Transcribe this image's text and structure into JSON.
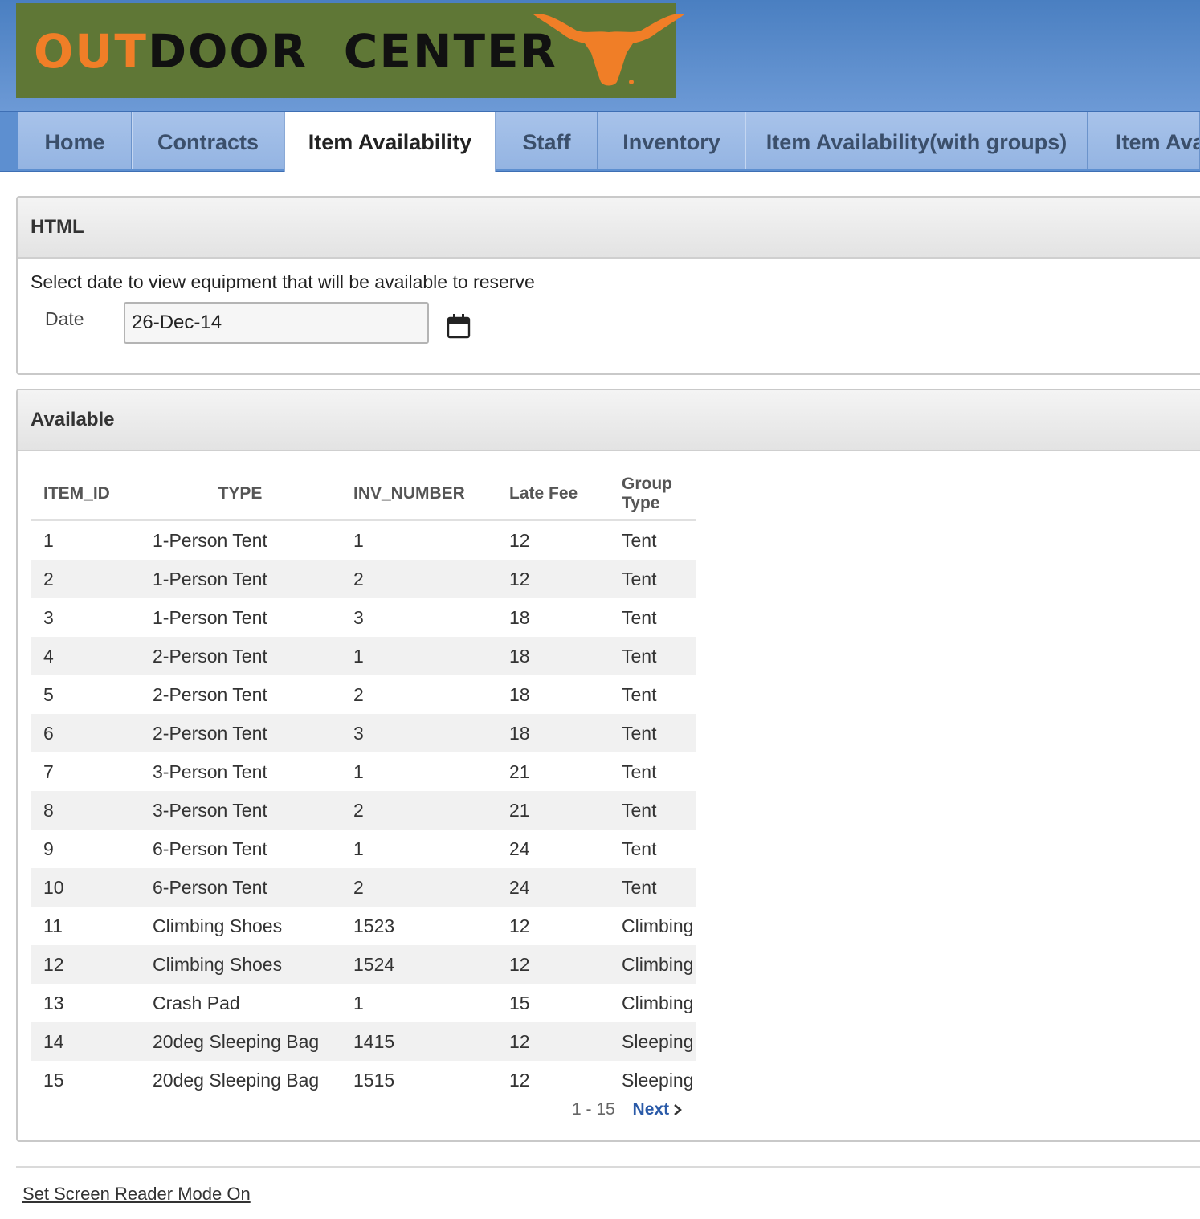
{
  "header": {
    "logo_text_part1": "OUT",
    "logo_text_part2": "DOOR  CENTER",
    "logo_color": "#5f7736",
    "accent_color": "#f07e27"
  },
  "tabs": [
    {
      "label": "Home"
    },
    {
      "label": "Contracts"
    },
    {
      "label": "Item Availability",
      "active": true
    },
    {
      "label": "Staff"
    },
    {
      "label": "Inventory"
    },
    {
      "label": "Item Availability(with groups)"
    },
    {
      "label": "Item Ava"
    }
  ],
  "html_region": {
    "title": "HTML",
    "instructions": "Select date to view equipment that will be available to reserve",
    "date_label": "Date",
    "date_value": "26-Dec-14",
    "calendar_icon": "calendar-icon"
  },
  "available_region": {
    "title": "Available",
    "columns": [
      "ITEM_ID",
      "TYPE",
      "INV_NUMBER",
      "Late Fee",
      "Group Type"
    ],
    "rows": [
      [
        "1",
        "1-Person Tent",
        "1",
        "12",
        "Tent"
      ],
      [
        "2",
        "1-Person Tent",
        "2",
        "12",
        "Tent"
      ],
      [
        "3",
        "1-Person Tent",
        "3",
        "18",
        "Tent"
      ],
      [
        "4",
        "2-Person Tent",
        "1",
        "18",
        "Tent"
      ],
      [
        "5",
        "2-Person Tent",
        "2",
        "18",
        "Tent"
      ],
      [
        "6",
        "2-Person Tent",
        "3",
        "18",
        "Tent"
      ],
      [
        "7",
        "3-Person Tent",
        "1",
        "21",
        "Tent"
      ],
      [
        "8",
        "3-Person Tent",
        "2",
        "21",
        "Tent"
      ],
      [
        "9",
        "6-Person Tent",
        "1",
        "24",
        "Tent"
      ],
      [
        "10",
        "6-Person Tent",
        "2",
        "24",
        "Tent"
      ],
      [
        "11",
        "Climbing Shoes",
        "1523",
        "12",
        "Climbing"
      ],
      [
        "12",
        "Climbing Shoes",
        "1524",
        "12",
        "Climbing"
      ],
      [
        "13",
        "Crash Pad",
        "1",
        "15",
        "Climbing"
      ],
      [
        "14",
        "20deg Sleeping Bag",
        "1415",
        "12",
        "Sleeping"
      ],
      [
        "15",
        "20deg Sleeping Bag",
        "1515",
        "12",
        "Sleeping"
      ]
    ],
    "pagination": {
      "range": "1 - 15",
      "next_label": "Next",
      "next_icon": "chevron-right-icon"
    }
  },
  "footer": {
    "screen_reader_link": "Set Screen Reader Mode On"
  }
}
